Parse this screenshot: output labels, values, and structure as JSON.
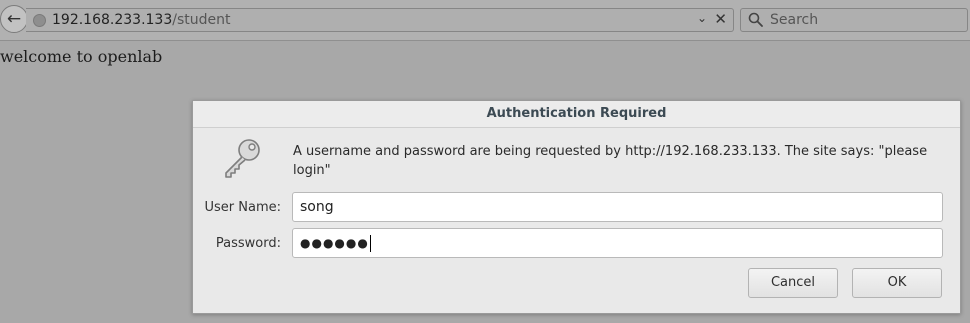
{
  "toolbar": {
    "back_icon": "back-arrow-icon",
    "url_host": "192.168.233.133",
    "url_path": "/student",
    "search_placeholder": "Search"
  },
  "page": {
    "welcome_text": "welcome to openlab"
  },
  "dialog": {
    "title": "Authentication Required",
    "message": "A username and password are being requested by http://192.168.233.133. The site says: \"please login\"",
    "username_label": "User Name:",
    "username_value": "song",
    "password_label": "Password:",
    "password_mask": "●●●●●●",
    "cancel_label": "Cancel",
    "ok_label": "OK"
  }
}
